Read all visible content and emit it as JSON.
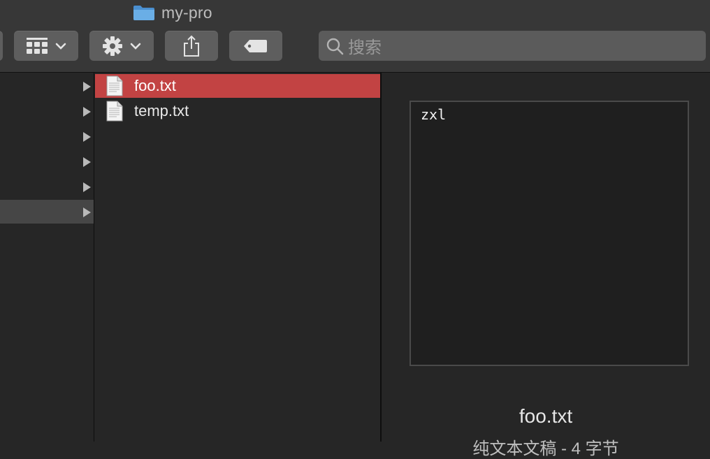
{
  "window": {
    "title": "my-pro"
  },
  "toolbar": {
    "view_icon": "grid-view-icon",
    "action_icon": "gear-icon",
    "share_icon": "share-icon",
    "tag_icon": "tag-icon",
    "search": {
      "placeholder": "搜索",
      "icon": "search-icon"
    }
  },
  "sidebar_column": {
    "row_count": 6,
    "selected_index": 5
  },
  "files": [
    {
      "name": "foo.txt",
      "selected": true
    },
    {
      "name": "temp.txt",
      "selected": false
    }
  ],
  "preview": {
    "content": "zxl",
    "file_name": "foo.txt",
    "kind": "纯文本文稿 - 4 字节"
  },
  "colors": {
    "selection": "#c24343",
    "toolbar_bg": "#373737",
    "button_bg": "#5e5e5e",
    "window_bg": "#262626"
  }
}
